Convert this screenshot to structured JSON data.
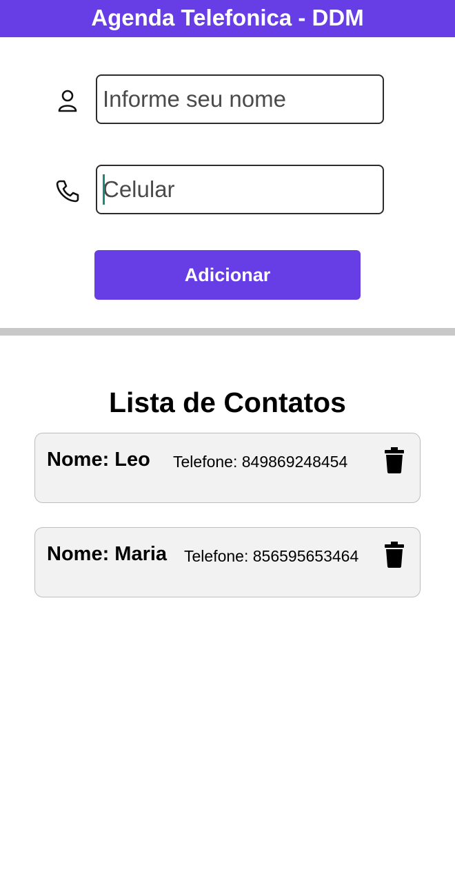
{
  "header": {
    "title": "Agenda Telefonica - DDM",
    "background_color": "#673de6"
  },
  "form": {
    "name_field": {
      "placeholder": "Informe seu nome",
      "value": "",
      "icon": "person-icon"
    },
    "phone_field": {
      "placeholder": "Celular",
      "value": "",
      "icon": "phone-icon",
      "focused": true
    },
    "add_button_label": "Adicionar",
    "accent_color": "#673de6"
  },
  "contacts": {
    "title": "Lista de Contatos",
    "items": [
      {
        "name": "Nome: Leo",
        "phone": "Telefone: 849869248454",
        "delete_icon": "trash-icon"
      },
      {
        "name": "Nome: Maria",
        "phone": "Telefone: 856595653464",
        "delete_icon": "trash-icon"
      }
    ]
  }
}
